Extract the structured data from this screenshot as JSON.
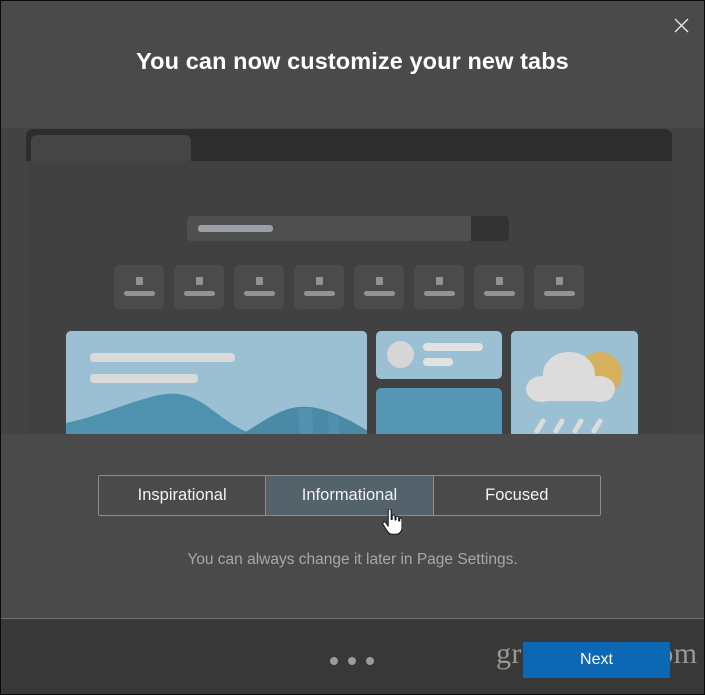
{
  "dialog": {
    "title": "You can now customize your new tabs",
    "close_icon": "close-icon",
    "close_label": "Close"
  },
  "preview": {
    "browser_mock_name": "new-tab-page-preview",
    "searchbar_placeholder_bar": "",
    "tile_count": 8,
    "cards": [
      {
        "name": "hero-image-card",
        "kind": "image"
      },
      {
        "name": "article-card",
        "kind": "article"
      },
      {
        "name": "solid-card",
        "kind": "solid"
      },
      {
        "name": "weather-card",
        "kind": "weather"
      }
    ]
  },
  "chooser": {
    "options": [
      {
        "label": "Inspirational",
        "selected": false
      },
      {
        "label": "Informational",
        "selected": true
      },
      {
        "label": "Focused",
        "selected": false
      }
    ],
    "hint": "You can always change it later in Page Settings."
  },
  "footer": {
    "next_label": "Next",
    "page_dots": 3,
    "current_page": 1
  },
  "watermark": {
    "text": "groovyPost.com"
  },
  "colors": {
    "dialog_bg": "#4a4a4a",
    "stage_bg": "#434343",
    "footer_bg": "#383838",
    "accent_blue": "#0c68b4",
    "selected_segment": "#53626b",
    "sky": "#9cc0d3",
    "mountain": "#4e92b0",
    "sun": "#d5b15e"
  }
}
